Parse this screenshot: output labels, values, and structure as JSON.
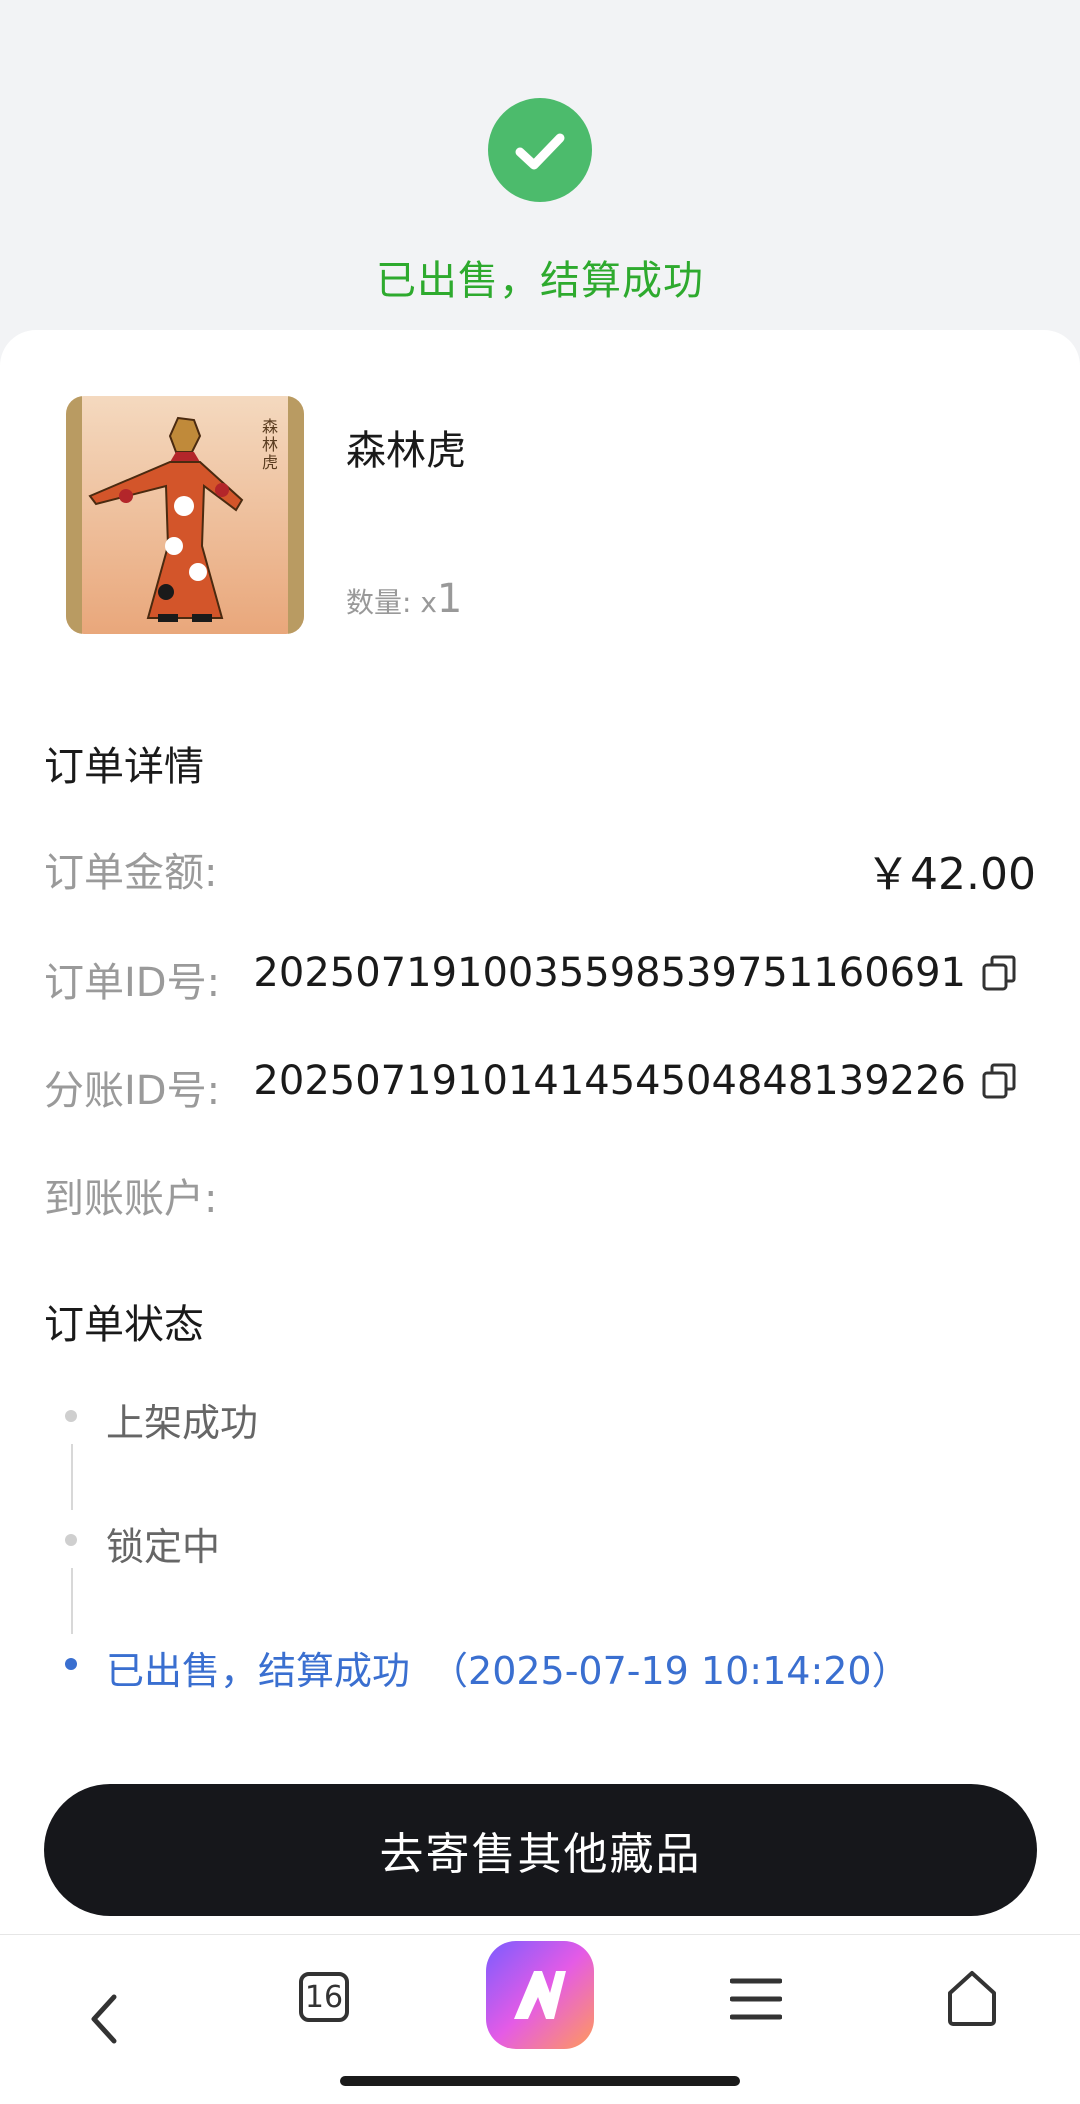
{
  "status": {
    "title": "已出售，结算成功",
    "icon": "check-circle-icon",
    "color": "#4cbb6c"
  },
  "product": {
    "name": "森林虎",
    "quantity_label": "数量:",
    "quantity_prefix": "x",
    "quantity": "1",
    "image_icon": "shadow-puppet-tiger-image"
  },
  "order_details": {
    "title": "订单详情",
    "rows": [
      {
        "label": "订单金额:",
        "value": "￥42.00"
      },
      {
        "label": "订单ID号:",
        "value": "2025071910035598539751160691"
      },
      {
        "label": "分账ID号:",
        "value": "2025071910141454504848139226"
      },
      {
        "label": "到账账户:",
        "value": ""
      }
    ]
  },
  "order_status": {
    "title": "订单状态",
    "steps": [
      {
        "label": "上架成功",
        "active": false
      },
      {
        "label": "锁定中",
        "active": false
      },
      {
        "label": "已出售，结算成功",
        "time": "（2025-07-19 10:14:20）",
        "active": true
      }
    ],
    "active_color": "#3a6fd0"
  },
  "cta": {
    "label": "去寄售其他藏品"
  },
  "navbar": {
    "back_icon": "back-icon",
    "tabs_count": "16",
    "app_icon": "app-logo-icon",
    "menu_icon": "menu-icon",
    "home_icon": "home-icon"
  }
}
